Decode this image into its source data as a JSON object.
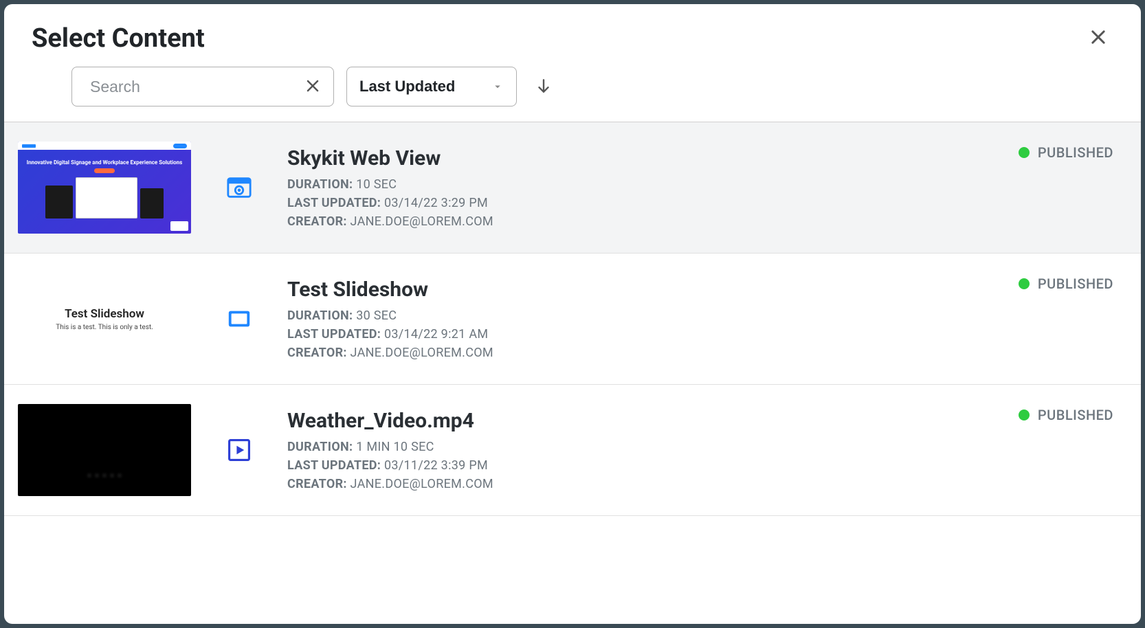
{
  "modal": {
    "title": "Select Content"
  },
  "toolbar": {
    "search_placeholder": "Search",
    "sort_label": "Last Updated"
  },
  "labels": {
    "duration": "DURATION:",
    "last_updated": "LAST UPDATED:",
    "creator": "CREATOR:"
  },
  "status_labels": {
    "published": "PUBLISHED"
  },
  "items": [
    {
      "title": "Skykit Web View",
      "type": "webview",
      "duration": "10 SEC",
      "last_updated": "03/14/22 3:29 PM",
      "creator": "JANE.DOE@LOREM.COM",
      "status": "published",
      "selected": true,
      "thumb": {
        "hero": "Innovative Digital Signage and\nWorkplace Experience Solutions"
      }
    },
    {
      "title": "Test Slideshow",
      "type": "slideshow",
      "duration": "30 SEC",
      "last_updated": "03/14/22 9:21 AM",
      "creator": "JANE.DOE@LOREM.COM",
      "status": "published",
      "selected": false,
      "thumb": {
        "line1": "Test Slideshow",
        "line2": "This is a test. This is only a test."
      }
    },
    {
      "title": "Weather_Video.mp4",
      "type": "video",
      "duration": "1 MIN 10 SEC",
      "last_updated": "03/11/22 3:39 PM",
      "creator": "JANE.DOE@LOREM.COM",
      "status": "published",
      "selected": false,
      "thumb": {}
    }
  ]
}
